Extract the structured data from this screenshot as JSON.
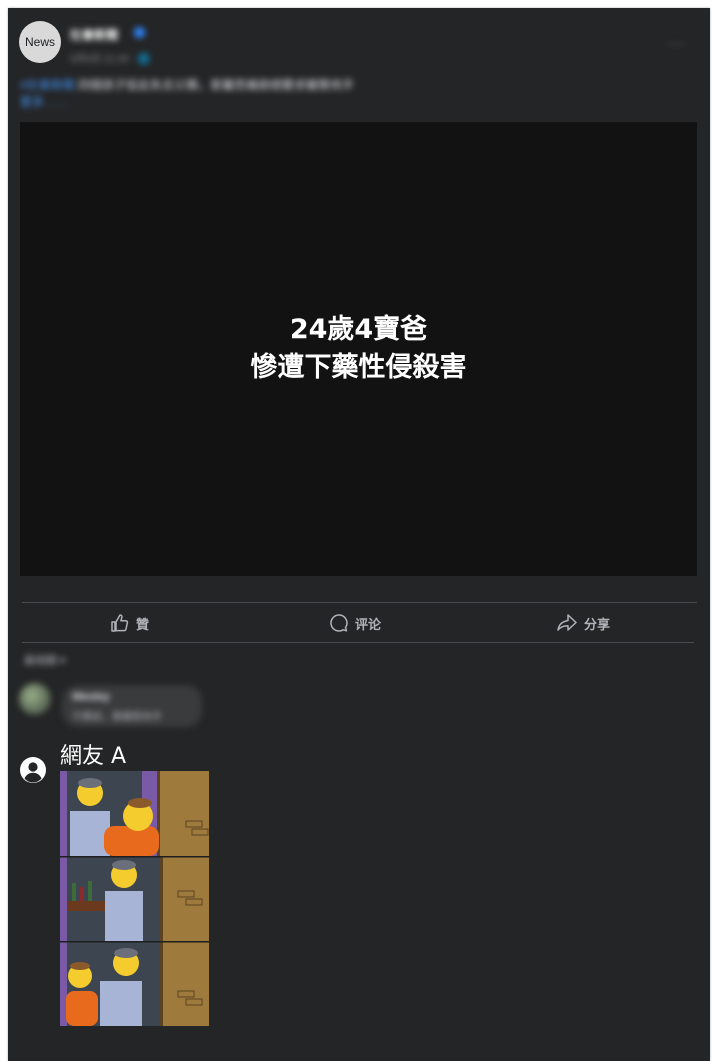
{
  "post": {
    "avatar_text": "News",
    "page_name": "社會新聞",
    "meta": "5月6日 21:40 · 🌐",
    "caption_tag": "#社會新聞",
    "caption_text": " 四個孩子從此失去父親，家屬悲痛欲絕要求嚴懲兇手",
    "see_more": "更多……",
    "more_icon": "···"
  },
  "video": {
    "line1": "24歲4寶爸",
    "line2": "慘遭下藥性侵殺害"
  },
  "actions": {
    "like_label": "贊",
    "comment_label": "评论",
    "share_label": "分享"
  },
  "comments": {
    "sort_label": "最相關 ▾",
    "first_name": "Wesley",
    "first_text": "不應該，要嚴懲兇手",
    "netizen_name": "網友 A"
  },
  "colors": {
    "card_bg": "#242526",
    "video_bg": "#121212",
    "link_blue": "#4599ff",
    "meme_purple": "#7a5aa6",
    "meme_wood": "#9e7a3c",
    "simpsons_yellow": "#f5cc2e"
  }
}
